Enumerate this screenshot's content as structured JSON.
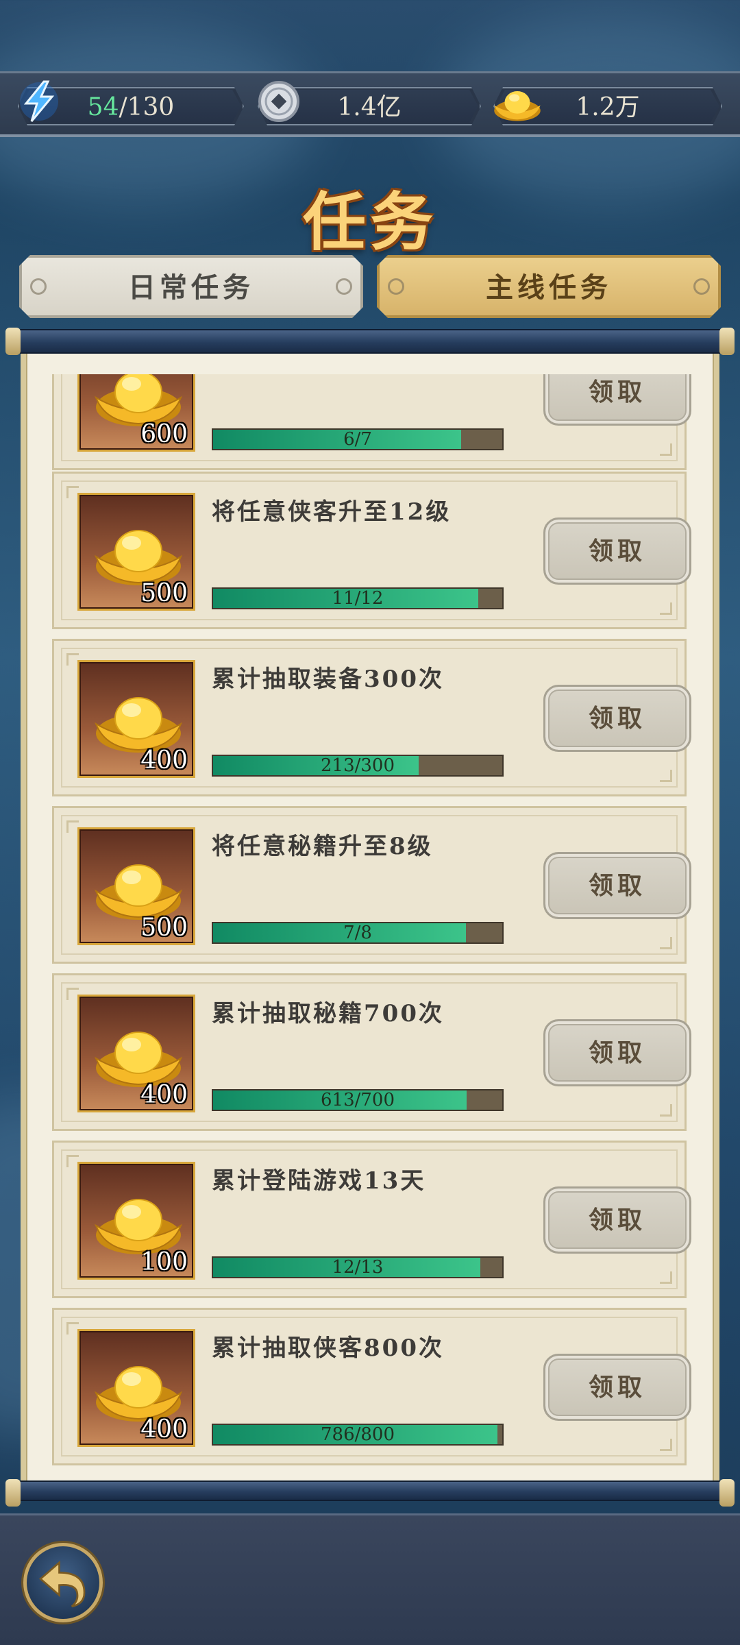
{
  "resources": {
    "stamina_current": "54",
    "stamina_max": "/130",
    "coins": "1.4亿",
    "gold_ingots": "1.2万"
  },
  "title": "任务",
  "tabs": {
    "daily": "日常任务",
    "main": "主线任务",
    "active": "main"
  },
  "tasks": [
    {
      "title": "",
      "reward": "600",
      "progress_text": "6/7",
      "progress": 0.857,
      "claim": "领取"
    },
    {
      "title": "将任意侠客升至12级",
      "reward": "500",
      "progress_text": "11/12",
      "progress": 0.917,
      "claim": "领取"
    },
    {
      "title": "累计抽取装备300次",
      "reward": "400",
      "progress_text": "213/300",
      "progress": 0.71,
      "claim": "领取"
    },
    {
      "title": "将任意秘籍升至8级",
      "reward": "500",
      "progress_text": "7/8",
      "progress": 0.875,
      "claim": "领取"
    },
    {
      "title": "累计抽取秘籍700次",
      "reward": "400",
      "progress_text": "613/700",
      "progress": 0.876,
      "claim": "领取"
    },
    {
      "title": "累计登陆游戏13天",
      "reward": "100",
      "progress_text": "12/13",
      "progress": 0.923,
      "claim": "领取"
    },
    {
      "title": "累计抽取侠客800次",
      "reward": "400",
      "progress_text": "786/800",
      "progress": 0.983,
      "claim": "领取"
    }
  ],
  "icons": {
    "stamina": "lightning-icon",
    "coin": "silver-coin-icon",
    "ingot": "gold-ingot-icon",
    "back": "back-arrow-icon"
  }
}
